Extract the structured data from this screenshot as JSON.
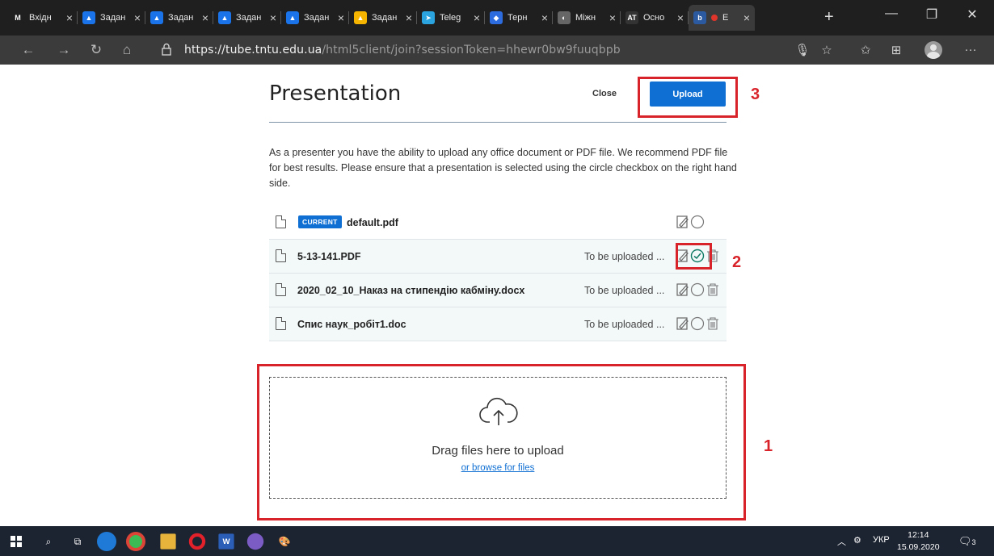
{
  "browser": {
    "tabs": [
      {
        "title": "Вхідн",
        "color": "#1f1f1f",
        "glyph": "M"
      },
      {
        "title": "Задан",
        "color": "#1a73e8",
        "glyph": "▲"
      },
      {
        "title": "Задан",
        "color": "#1a73e8",
        "glyph": "▲"
      },
      {
        "title": "Задан",
        "color": "#1a73e8",
        "glyph": "▲"
      },
      {
        "title": "Задан",
        "color": "#1a73e8",
        "glyph": "▲"
      },
      {
        "title": "Задан",
        "color": "#f4b400",
        "glyph": "▲"
      },
      {
        "title": "Teleg",
        "color": "#2aa3df",
        "glyph": "➤"
      },
      {
        "title": "Терн",
        "color": "#2d6cdf",
        "glyph": "◆"
      },
      {
        "title": "Міжн",
        "color": "#666666",
        "glyph": "◐"
      },
      {
        "title": "Осно",
        "color": "#333333",
        "glyph": "AT"
      },
      {
        "title": "E",
        "color": "#2c5aa0",
        "glyph": "b"
      }
    ],
    "url_host": "https://tube.tntu.edu.ua",
    "url_path": "/html5client/join?sessionToken=hhewr0bw9fuuqbpb"
  },
  "modal": {
    "title": "Presentation",
    "close_label": "Close",
    "upload_label": "Upload",
    "description": "As a presenter you have the ability to upload any office document or PDF file. We recommend PDF file for best results. Please ensure that a presentation is selected using the circle checkbox on the right hand side.",
    "current_badge": "CURRENT",
    "files": [
      {
        "name": "default.pdf",
        "status": "",
        "current": true,
        "selected": false
      },
      {
        "name": "5-13-141.PDF",
        "status": "To be uploaded ...",
        "current": false,
        "selected": true
      },
      {
        "name": "2020_02_10_Наказ на стипендію кабміну.docx",
        "status": "To be uploaded ...",
        "current": false,
        "selected": false
      },
      {
        "name": "Спис наук_робіт1.doc",
        "status": "To be uploaded ...",
        "current": false,
        "selected": false
      }
    ],
    "drop_text": "Drag files here to upload",
    "browse_text": "or browse for files"
  },
  "annotations": {
    "n1": "1",
    "n2": "2",
    "n3": "3",
    "color": "#d9232a"
  },
  "taskbar": {
    "language": "УКР",
    "time": "12:14",
    "date": "15.09.2020",
    "notifications": "3"
  }
}
